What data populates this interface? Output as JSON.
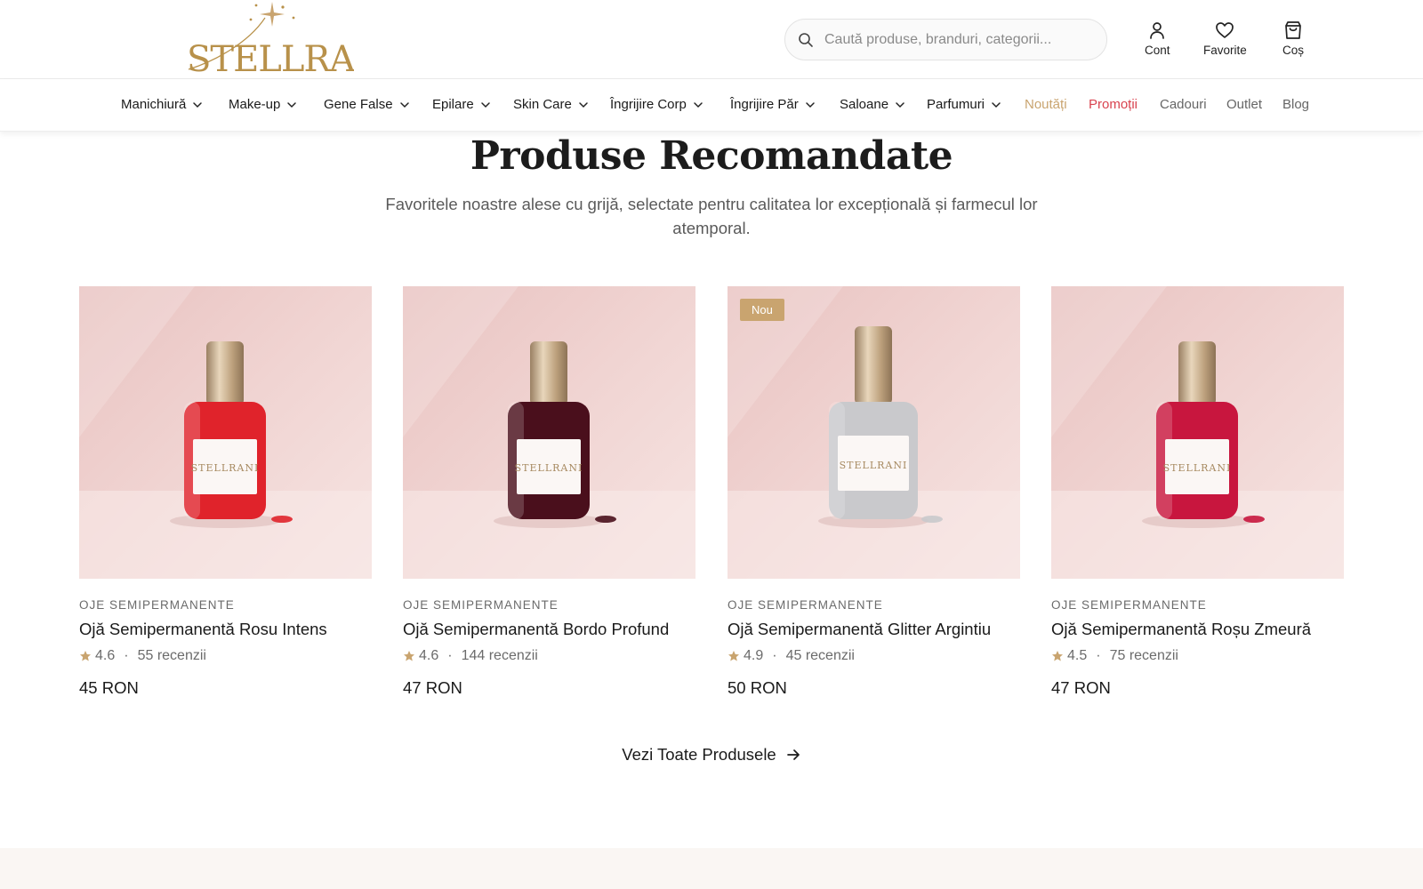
{
  "brand": {
    "logo_text": "STELLRANI",
    "accent_gold": "#b8914a"
  },
  "search": {
    "placeholder": "Caută produse, branduri, categorii..."
  },
  "header_actions": [
    {
      "label": "Cont",
      "icon": "user-icon"
    },
    {
      "label": "Favorite",
      "icon": "heart-icon"
    },
    {
      "label": "Coș",
      "icon": "shopping-bag-icon"
    }
  ],
  "nav": {
    "items": [
      {
        "label": "Manichiură",
        "dropdown": true
      },
      {
        "label": "Make-up",
        "dropdown": true
      },
      {
        "label": "Gene False",
        "dropdown": true
      },
      {
        "label": "Epilare",
        "dropdown": true
      },
      {
        "label": "Skin Care",
        "dropdown": true
      },
      {
        "label": "Îngrijire Corp",
        "dropdown": true
      },
      {
        "label": "Îngrijire Păr",
        "dropdown": true
      },
      {
        "label": "Saloane",
        "dropdown": true
      },
      {
        "label": "Parfumuri",
        "dropdown": true
      },
      {
        "label": "Noutăți",
        "dropdown": false,
        "color": "#c9a46f"
      },
      {
        "label": "Promoții",
        "dropdown": false,
        "color": "#d9434f"
      },
      {
        "label": "Cadouri",
        "dropdown": false,
        "color": "#666666"
      },
      {
        "label": "Outlet",
        "dropdown": false,
        "color": "#666666"
      },
      {
        "label": "Blog",
        "dropdown": false,
        "color": "#666666"
      }
    ]
  },
  "section": {
    "title": "Produse Recomandate",
    "subtitle": "Favoritele noastre alese cu grijă, selectate pentru calitatea lor excepțională și farmecul lor atemporal."
  },
  "products": [
    {
      "category": "OJE SEMIPERMANENTE",
      "name": "Ojă Semipermanentă Rosu Intens",
      "rating": "4.6",
      "reviews": "55 recenzii",
      "price": "45 RON",
      "badge": "",
      "polish_color": "#e0232b",
      "label": "STELLRANI"
    },
    {
      "category": "OJE SEMIPERMANENTE",
      "name": "Ojă Semipermanentă Bordo Profund",
      "rating": "4.6",
      "reviews": "144 recenzii",
      "price": "47 RON",
      "badge": "",
      "polish_color": "#4a0f1c",
      "label": "STELLRANI"
    },
    {
      "category": "OJE SEMIPERMANENTE",
      "name": "Ojă Semipermanentă Glitter Argintiu",
      "rating": "4.9",
      "reviews": "45 recenzii",
      "price": "50 RON",
      "badge": "Nou",
      "polish_color": "#c9c9cc",
      "label": "STELLRANI"
    },
    {
      "category": "OJE SEMIPERMANENTE",
      "name": "Ojă Semipermanentă Roșu Zmeură",
      "rating": "4.5",
      "reviews": "75 recenzii",
      "price": "47 RON",
      "badge": "",
      "polish_color": "#c8163e",
      "label": "STELLRANI"
    }
  ],
  "view_all": {
    "label": "Vezi Toate Produsele"
  },
  "colors": {
    "star": "#c9a46f",
    "image_bg": "#ecc9c7"
  }
}
